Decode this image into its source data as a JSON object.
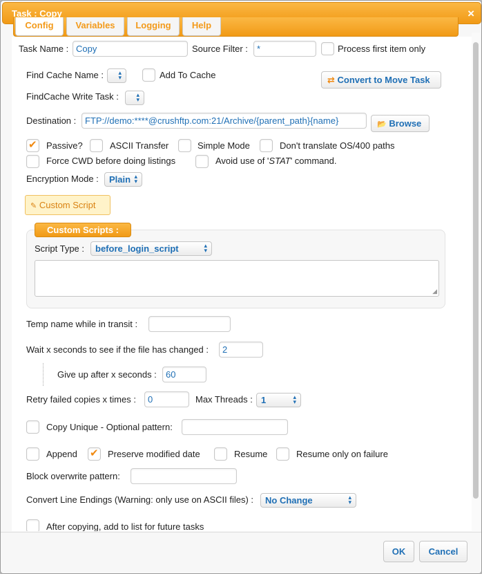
{
  "window": {
    "title": "Task : Copy",
    "close_icon": "×"
  },
  "tabs": [
    {
      "label": "Config"
    },
    {
      "label": "Variables"
    },
    {
      "label": "Logging"
    },
    {
      "label": "Help"
    }
  ],
  "form": {
    "task_name_label": "Task Name :",
    "task_name_value": "Copy",
    "source_filter_label": "Source Filter :",
    "source_filter_value": "*",
    "process_first_label": "Process first item only",
    "find_cache_label": "Find Cache Name :",
    "add_to_cache_label": "Add To Cache",
    "convert_button_label": "Convert to Move Task",
    "convert_icon": "⇄",
    "findcache_write_label": "FindCache Write Task :",
    "destination_label": "Destination :",
    "destination_value": "FTP://demo:****@crushftp.com:21/Archive/{parent_path}{name}",
    "browse_label": "Browse",
    "browse_icon": "📂",
    "passive_label": "Passive?",
    "ascii_label": "ASCII Transfer",
    "simple_mode_label": "Simple Mode",
    "dont_translate_label": "Don't translate OS/400 paths",
    "force_cwd_label": "Force CWD before doing listings",
    "avoid_stat_prefix": "Avoid use of '",
    "avoid_stat_italic": "STAT",
    "avoid_stat_suffix": "' command.",
    "encryption_label": "Encryption Mode :",
    "encryption_value": "Plain",
    "custom_script_button": "Custom Script",
    "custom_script_icon": "✎",
    "custom_scripts_legend": "Custom Scripts :",
    "script_type_label": "Script Type :",
    "script_type_value": "before_login_script",
    "temp_name_label": "Temp name while in transit :",
    "temp_name_value": "",
    "wait_label": "Wait x seconds to see if the file has changed :",
    "wait_value": "2",
    "give_up_label": "Give up after x seconds :",
    "give_up_value": "60",
    "retry_label": "Retry failed copies x times :",
    "retry_value": "0",
    "max_threads_label": "Max Threads :",
    "max_threads_value": "1",
    "copy_unique_label": "Copy Unique - Optional pattern:",
    "copy_unique_value": "",
    "append_label": "Append",
    "preserve_label": "Preserve modified date",
    "resume_label": "Resume",
    "resume_failure_label": "Resume only on failure",
    "block_overwrite_label": "Block overwrite pattern:",
    "block_overwrite_value": "",
    "convert_endings_label": "Convert Line Endings (Warning: only use on ASCII files) :",
    "convert_endings_value": "No Change",
    "after_copying_label": "After copying, add to list for future tasks"
  },
  "checkbox_states": {
    "process_first": false,
    "add_to_cache": false,
    "passive": true,
    "ascii": false,
    "simple_mode": false,
    "dont_translate": false,
    "force_cwd": false,
    "avoid_stat": false,
    "copy_unique": false,
    "append": false,
    "preserve": true,
    "resume": false,
    "resume_failure": false,
    "after_copying": false
  },
  "footer": {
    "ok_label": "OK",
    "cancel_label": "Cancel"
  },
  "colors": {
    "accent": "#f39a1a",
    "link_blue": "#1f6fb5",
    "check_orange": "#f08a12"
  }
}
